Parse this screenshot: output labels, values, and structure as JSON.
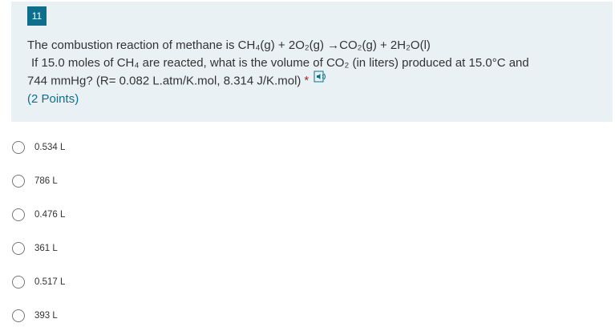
{
  "question": {
    "number": "11",
    "line1": "The combustion reaction of methane  is  CH₄(g) + 2O₂(g)  →CO₂(g) + 2H₂O(l)",
    "line2": "If 15.0 moles of CH₄ are reacted, what is the volume of CO₂ (in liters) produced at 15.0°C and",
    "line3": "744 mmHg? (R= 0.082 L.atm/K.mol, 8.314 J/K.mol)",
    "required_mark": "*",
    "points": "(2 Points)",
    "speaker_icon": "immersive-reader-speaker-icon"
  },
  "options": [
    {
      "label": "0.534 L"
    },
    {
      "label": "786 L"
    },
    {
      "label": "0.476 L"
    },
    {
      "label": "361 L"
    },
    {
      "label": "0.517 L"
    },
    {
      "label": "393 L"
    }
  ],
  "colors": {
    "card_background": "#eaf1f4",
    "badge_background": "#0f6e8c",
    "required": "#a4262c",
    "points": "#0f6e8c"
  }
}
